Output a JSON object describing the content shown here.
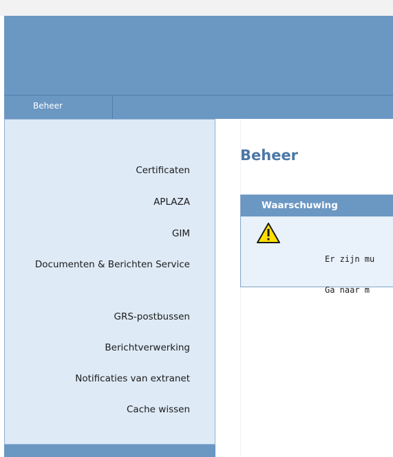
{
  "nav": {
    "tabs": [
      {
        "label": "Beheer"
      }
    ]
  },
  "sidebar": {
    "items": [
      {
        "label": "Certificaten"
      },
      {
        "label": "APLAZA"
      },
      {
        "label": "GIM"
      },
      {
        "label": "Documenten & Berichten Service"
      },
      {
        "label": "GRS-postbussen"
      },
      {
        "label": "Berichtverwerking"
      },
      {
        "label": "Notificaties van extranet"
      },
      {
        "label": "Cache wissen"
      }
    ]
  },
  "main": {
    "title": "Beheer",
    "warning": {
      "header": "Waarschuwing",
      "icon": "warning-triangle-icon",
      "line1": "Er zijn mu",
      "line2": "Ga naar m"
    }
  },
  "colors": {
    "header_blue": "#6b97c3",
    "sidebar_bg": "#deeaf6",
    "title_blue": "#4b77a6",
    "warning_bg": "#e9f2fb",
    "warning_icon_yellow": "#ffe000"
  }
}
